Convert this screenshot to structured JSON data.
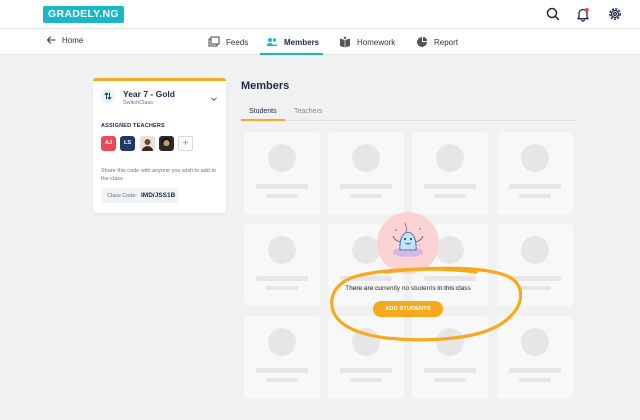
{
  "header": {
    "logo_text": "GRADELY.NG",
    "icons": [
      "search-icon",
      "bell-icon",
      "gear-icon"
    ],
    "brand_color": "#1bb7c9"
  },
  "nav": {
    "home_label": "Home",
    "tabs": [
      {
        "label": "Feeds",
        "icon": "feeds-icon",
        "active": false
      },
      {
        "label": "Members",
        "icon": "members-icon",
        "active": true
      },
      {
        "label": "Homework",
        "icon": "homework-icon",
        "active": false
      },
      {
        "label": "Report",
        "icon": "report-icon",
        "active": false
      }
    ]
  },
  "class_card": {
    "name": "Year 7 - Gold",
    "switch_label": "SwitchClass",
    "assigned_label": "ASSIGNED TEACHERS",
    "teachers": [
      {
        "initials": "AJ",
        "color": "#e94b55"
      },
      {
        "initials": "LS",
        "color": "#1f3a68"
      },
      {
        "initials": "",
        "color": "#6b4a3a"
      },
      {
        "initials": "",
        "color": "#2a2a2a"
      }
    ],
    "add_label": "+",
    "share_text": "Share this code with anyone you wish to add to the class",
    "code_label": "Class Code:",
    "code_value": "IMD/JSS1B",
    "accent_color": "#f7a91e"
  },
  "members": {
    "title": "Members",
    "tabs": [
      {
        "label": "Students",
        "active": true
      },
      {
        "label": "Teachers",
        "active": false
      }
    ],
    "empty_message": "There are currently no students in this class",
    "add_button_label": "ADD STUDENTS"
  }
}
